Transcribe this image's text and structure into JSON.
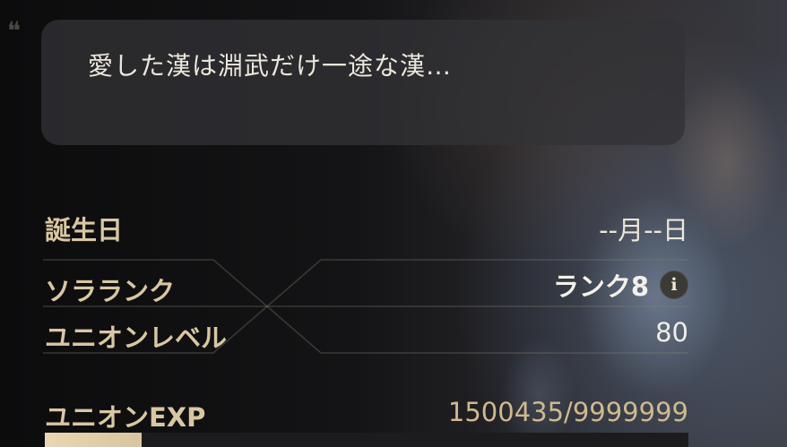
{
  "quote": {
    "text": "愛した漢は淵武だけ一途な漢…"
  },
  "profile": {
    "birthday": {
      "label": "誕生日",
      "value": "--月--日"
    },
    "sora_rank": {
      "label": "ソラランク",
      "value": "ランク8",
      "info_icon": "info-icon"
    },
    "union_level": {
      "label": "ユニオンレベル",
      "value": "80"
    },
    "union_exp": {
      "label": "ユニオンEXP",
      "value": "1500435/9999999",
      "progress_fraction": 0.15
    }
  },
  "colors": {
    "label": "#d9c7a3",
    "value": "#f1ede6",
    "exp_value": "#cfb98f",
    "exp_fill": "#e8d7b2"
  }
}
